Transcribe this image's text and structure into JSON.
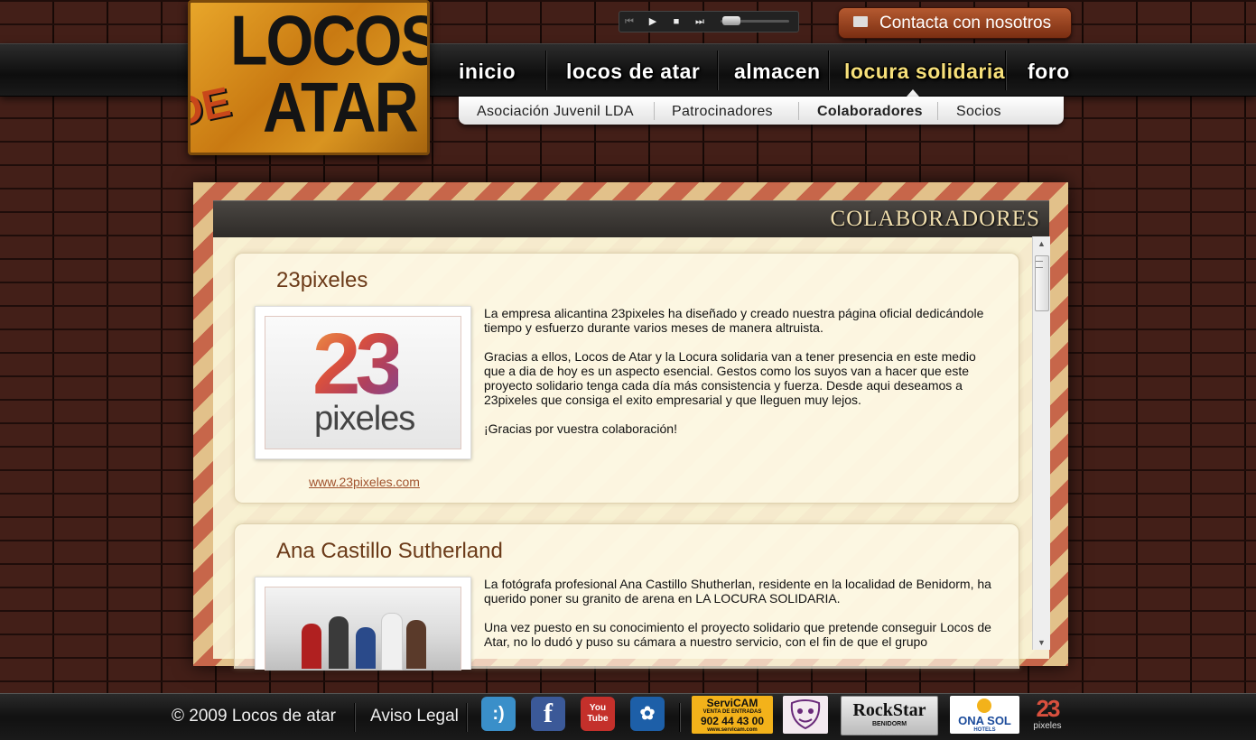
{
  "logo": {
    "line1": "LOCOS",
    "line2": "ATAR",
    "de": "DE"
  },
  "player": {
    "prev": "⏮",
    "play": "▶",
    "stop": "■",
    "next": "⏭"
  },
  "contact": {
    "label": "Contacta con nosotros"
  },
  "nav": {
    "items": [
      {
        "label": "inicio"
      },
      {
        "label": "locos de atar"
      },
      {
        "label": "almacen"
      },
      {
        "label": "locura solidaria"
      },
      {
        "label": "foro"
      }
    ],
    "active": "locura solidaria"
  },
  "subnav": {
    "items": [
      {
        "label": "Asociación Juvenil LDA"
      },
      {
        "label": "Patrocinadores"
      },
      {
        "label": "Colaboradores"
      },
      {
        "label": "Socios"
      }
    ],
    "active": "Colaboradores"
  },
  "panel": {
    "title": "COLABORADORES",
    "scroll_up": "▲",
    "scroll_down": "▼",
    "cards": [
      {
        "title": "23pixeles",
        "logo_number": "23",
        "logo_word": "pixeles",
        "paragraphs": [
          "La empresa alicantina 23pixeles ha diseñado y creado nuestra página oficial dedicándole tiempo y esfuerzo durante varios meses de manera altruista.",
          "Gracias a ellos, Locos de Atar y la Locura solidaria van a tener presencia en este medio que a dia de hoy es un aspecto esencial. Gestos como los suyos van a hacer que este proyecto solidario tenga cada día más consistencia y fuerza. Desde aqui deseamos a 23pixeles que consiga el exito empresarial y que lleguen muy lejos.",
          "¡Gracias por vuestra colaboración!"
        ],
        "link": "www.23pixeles.com"
      },
      {
        "title": "Ana Castillo Sutherland",
        "paragraphs": [
          "La fotógrafa profesional Ana Castillo Shutherlan, residente en la localidad de Benidorm, ha querido poner su granito de arena en LA LOCURA SOLIDARIA.",
          "Una vez puesto en su conocimiento el proyecto solidario que pretende conseguir Locos de Atar, no lo dudó y puso su cámara a nuestro servicio, con el fin de que el grupo"
        ]
      }
    ]
  },
  "footer": {
    "copyright": "© 2009  Locos de atar",
    "legal": "Aviso Legal",
    "social": [
      {
        "name": "tuenti-icon",
        "glyph": ":)",
        "color": "#3a8fc9"
      },
      {
        "name": "facebook-icon",
        "glyph": "f",
        "color": "#3b5998"
      },
      {
        "name": "youtube-icon",
        "glyph": "You Tube",
        "color": "#c4302b"
      },
      {
        "name": "myspace-icon",
        "glyph": "✿",
        "color": "#1d5fa8"
      }
    ],
    "sponsors": {
      "servicam": {
        "name": "ServiCAM",
        "sub": "VENTA DE ENTRADAS",
        "phone": "902 44 43 00",
        "web": "www.servicam.com"
      },
      "rockstar": {
        "name": "RockStar",
        "sub": "BENIDORM"
      },
      "onasol": {
        "name": "ONA SOL",
        "sub": "HOTELS"
      },
      "pixeles": {
        "number": "23",
        "word": "pixeles"
      }
    }
  },
  "colors": {
    "accent": "#f7e07a",
    "title_brown": "#6b3a18",
    "link": "#a0522d"
  }
}
